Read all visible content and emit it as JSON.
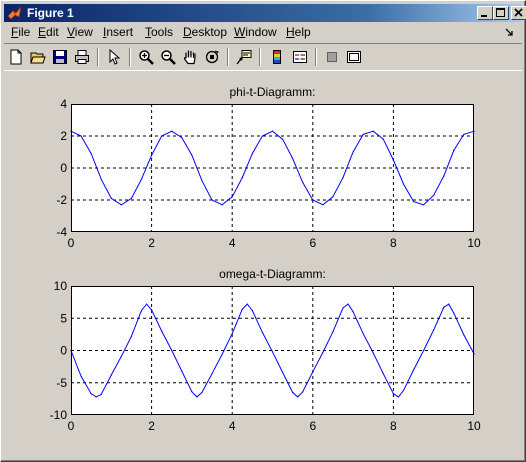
{
  "window": {
    "title": "Figure 1",
    "controls": [
      "minimize",
      "maximize",
      "close"
    ]
  },
  "menu": {
    "items": [
      {
        "label": "File",
        "underline": "F"
      },
      {
        "label": "Edit",
        "underline": "E"
      },
      {
        "label": "View",
        "underline": "V"
      },
      {
        "label": "Insert",
        "underline": "I"
      },
      {
        "label": "Tools",
        "underline": "T"
      },
      {
        "label": "Desktop",
        "underline": "D"
      },
      {
        "label": "Window",
        "underline": "W"
      },
      {
        "label": "Help",
        "underline": "H"
      }
    ]
  },
  "toolbar": {
    "tools": [
      "new-file-icon",
      "open-folder-icon",
      "save-icon",
      "print-icon",
      "pointer-arrow-icon",
      "zoom-in-icon",
      "zoom-out-icon",
      "pan-hand-icon",
      "rotate-3d-icon",
      "data-cursor-icon",
      "colorbar-icon",
      "legend-icon",
      "hide-plot-tools-icon",
      "show-plot-tools-icon"
    ]
  },
  "colors": {
    "line": "#0000ff",
    "axes_bg": "#ffffff",
    "figure_bg": "#d4d0c8",
    "title_bar": "#0a246a"
  },
  "chart_data": [
    {
      "type": "line",
      "title": "phi-t-Diagramm:",
      "xlabel": "",
      "ylabel": "",
      "xlim": [
        0,
        10
      ],
      "ylim": [
        -4,
        4
      ],
      "xticks": [
        0,
        2,
        4,
        6,
        8,
        10
      ],
      "yticks": [
        -4,
        -2,
        0,
        2,
        4
      ],
      "grid": "dashed",
      "series": [
        {
          "x": [
            0,
            0.25,
            0.5,
            0.75,
            1.0,
            1.25,
            1.5,
            1.75,
            2.0,
            2.25,
            2.5,
            2.75,
            3.0,
            3.25,
            3.5,
            3.75,
            4.0,
            4.25,
            4.5,
            4.75,
            5.0,
            5.25,
            5.5,
            5.75,
            6.0,
            6.25,
            6.5,
            6.75,
            7.0,
            7.25,
            7.5,
            7.75,
            8.0,
            8.25,
            8.5,
            8.75,
            9.0,
            9.25,
            9.5,
            9.75,
            10.0
          ],
          "y": [
            2.3,
            2.0,
            0.9,
            -0.7,
            -1.9,
            -2.3,
            -1.9,
            -0.7,
            0.8,
            2.0,
            2.3,
            1.9,
            0.8,
            -0.8,
            -2.0,
            -2.3,
            -1.8,
            -0.6,
            0.9,
            2.0,
            2.3,
            1.8,
            0.6,
            -0.9,
            -2.0,
            -2.3,
            -1.8,
            -0.6,
            1.0,
            2.1,
            2.3,
            1.8,
            0.5,
            -1.0,
            -2.1,
            -2.3,
            -1.7,
            -0.5,
            1.1,
            2.1,
            2.3
          ]
        }
      ]
    },
    {
      "type": "line",
      "title": "omega-t-Diagramm:",
      "xlabel": "",
      "ylabel": "",
      "xlim": [
        0,
        10
      ],
      "ylim": [
        -10,
        10
      ],
      "xticks": [
        0,
        2,
        4,
        6,
        8,
        10
      ],
      "yticks": [
        -10,
        -5,
        0,
        5,
        10
      ],
      "grid": "dashed",
      "series": [
        {
          "x": [
            0,
            0.25,
            0.5,
            0.625,
            0.75,
            1.0,
            1.25,
            1.5,
            1.75,
            1.875,
            2.0,
            2.25,
            2.5,
            2.75,
            3.0,
            3.125,
            3.25,
            3.5,
            3.75,
            4.0,
            4.25,
            4.375,
            4.5,
            4.75,
            5.0,
            5.25,
            5.5,
            5.625,
            5.75,
            6.0,
            6.25,
            6.5,
            6.75,
            6.875,
            7.0,
            7.25,
            7.5,
            7.75,
            8.0,
            8.125,
            8.25,
            8.5,
            8.75,
            9.0,
            9.25,
            9.375,
            9.5,
            9.75,
            10.0
          ],
          "y": [
            0,
            -4.0,
            -6.7,
            -7.2,
            -6.8,
            -3.8,
            -0.9,
            2.2,
            6.2,
            7.2,
            6.3,
            3.0,
            0,
            -3.2,
            -6.4,
            -7.2,
            -6.5,
            -3.6,
            -0.6,
            2.6,
            6.4,
            7.2,
            6.2,
            2.8,
            -0.2,
            -3.4,
            -6.5,
            -7.2,
            -6.4,
            -3.3,
            -0.3,
            2.9,
            6.6,
            7.2,
            6.0,
            2.6,
            -0.4,
            -3.6,
            -6.7,
            -7.2,
            -6.2,
            -3.0,
            0,
            3.2,
            6.7,
            7.2,
            5.8,
            2.4,
            -0.5
          ]
        }
      ]
    }
  ]
}
